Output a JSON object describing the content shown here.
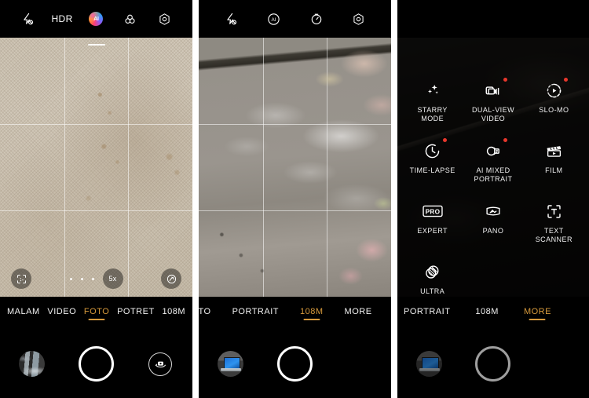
{
  "panels": [
    {
      "id": "photo-mode-panel",
      "topbar": [
        {
          "name": "flash-off-icon",
          "label": ""
        },
        {
          "name": "hdr-icon",
          "label": "HDR"
        },
        {
          "name": "ai-scene-icon",
          "label": "AI"
        },
        {
          "name": "filters-icon",
          "label": ""
        },
        {
          "name": "settings-icon",
          "label": ""
        }
      ],
      "viewfinder": {
        "scene": "beige woven fabric texture",
        "grid": true,
        "level_indicator": true
      },
      "zoom": {
        "value": "5x",
        "dots": 4
      },
      "modes": [
        {
          "label": "MALAM",
          "active": false
        },
        {
          "label": "VIDEO",
          "active": false
        },
        {
          "label": "FOTO",
          "active": true
        },
        {
          "label": "POTRET",
          "active": false
        },
        {
          "label": "108M",
          "active": false
        }
      ],
      "shutter": {
        "enabled": true
      },
      "thumbnail": "last-photo-thumbnail",
      "switch_camera": true
    },
    {
      "id": "108m-mode-panel",
      "topbar": [
        {
          "name": "flash-off-icon",
          "label": ""
        },
        {
          "name": "ai-scene-icon",
          "label": "AI"
        },
        {
          "name": "timer-icon",
          "label": ""
        },
        {
          "name": "settings-icon",
          "label": ""
        }
      ],
      "viewfinder": {
        "scene": "grey marble floor with patterned rug edge",
        "grid": true,
        "level_indicator": false
      },
      "modes": [
        {
          "label": "HOTO",
          "active": false
        },
        {
          "label": "PORTRAIT",
          "active": false
        },
        {
          "label": "108M",
          "active": true
        },
        {
          "label": "MORE",
          "active": false
        }
      ],
      "shutter": {
        "enabled": true
      },
      "thumbnail": "last-photo-thumbnail",
      "switch_camera": false
    },
    {
      "id": "more-modes-panel",
      "topbar": [],
      "viewfinder": {
        "scene": "dark dimmed preview",
        "grid": false,
        "level_indicator": false
      },
      "more_modes": [
        {
          "label": "STARRY\nMODE",
          "icon": "sparkle-icon",
          "badge": false
        },
        {
          "label": "DUAL-VIEW\nVIDEO",
          "icon": "dual-view-video-icon",
          "badge": true
        },
        {
          "label": "SLO-MO",
          "icon": "slow-motion-icon",
          "badge": true
        },
        {
          "label": "TIME-LAPSE",
          "icon": "clock-icon",
          "badge": true
        },
        {
          "label": "AI MIXED\nPORTRAIT",
          "icon": "ai-mixed-portrait-icon",
          "badge": true
        },
        {
          "label": "FILM",
          "icon": "clapperboard-icon",
          "badge": false
        },
        {
          "label": "EXPERT",
          "icon": "pro-icon",
          "badge": false
        },
        {
          "label": "PANO",
          "icon": "panorama-icon",
          "badge": false
        },
        {
          "label": "TEXT\nSCANNER",
          "icon": "text-scanner-icon",
          "badge": false
        },
        {
          "label": "ULTRA\nMACRO",
          "icon": "ultra-macro-icon",
          "badge": false
        }
      ],
      "modes": [
        {
          "label": "PORTRAIT",
          "active": false
        },
        {
          "label": "108M",
          "active": false
        },
        {
          "label": "MORE",
          "active": true
        }
      ],
      "shutter": {
        "enabled": false
      },
      "thumbnail": "last-photo-thumbnail",
      "switch_camera": false
    }
  ],
  "colors": {
    "accent": "#d79a3c",
    "badge": "#e8372c",
    "background": "#000000",
    "text": "#f2f2f2"
  }
}
